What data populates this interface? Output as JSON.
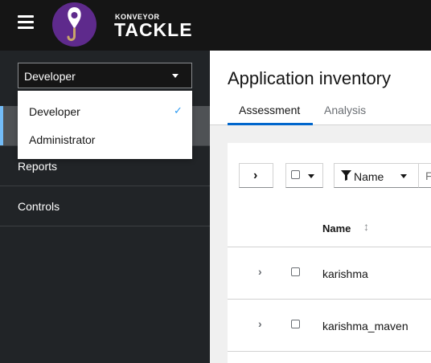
{
  "header": {
    "brand_small": "KONVEYOR",
    "brand_big": "TACKLE",
    "logo_color": "#5e2a8c"
  },
  "sidebar": {
    "perspective": {
      "selected": "Developer",
      "options": [
        {
          "label": "Developer",
          "selected": true
        },
        {
          "label": "Administrator",
          "selected": false
        }
      ]
    },
    "nav_items": [
      {
        "label": "",
        "active": true
      },
      {
        "label": "Reports",
        "active": false
      },
      {
        "label": "Controls",
        "active": false
      }
    ]
  },
  "main": {
    "title": "Application inventory",
    "tabs": [
      {
        "label": "Assessment",
        "active": true
      },
      {
        "label": "Analysis",
        "active": false
      }
    ],
    "toolbar": {
      "filter_label": "Name",
      "search_placeholder": "F"
    },
    "table": {
      "columns": [
        "Name"
      ],
      "rows": [
        {
          "name": "karishma"
        },
        {
          "name": "karishma_maven"
        }
      ]
    }
  },
  "colors": {
    "accent": "#0066cc",
    "check": "#2b9af3",
    "active_nav_bar": "#73bcf7"
  }
}
